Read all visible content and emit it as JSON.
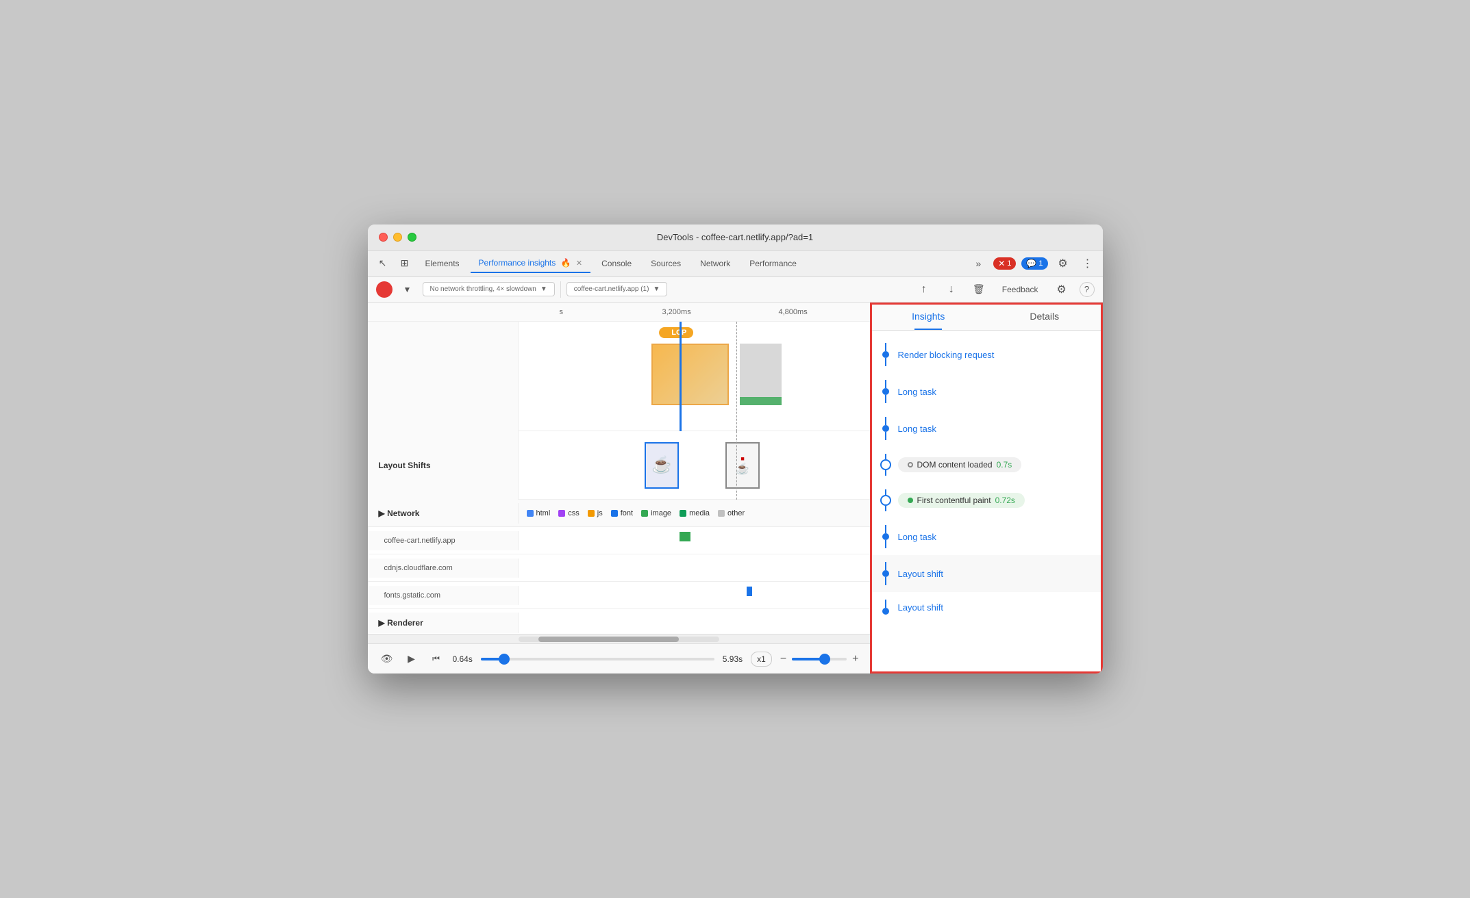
{
  "window": {
    "title": "DevTools - coffee-cart.netlify.app/?ad=1"
  },
  "tabs": [
    {
      "id": "elements",
      "label": "Elements",
      "active": false
    },
    {
      "id": "performance-insights",
      "label": "Performance insights",
      "active": true
    },
    {
      "id": "console",
      "label": "Console",
      "active": false
    },
    {
      "id": "sources",
      "label": "Sources",
      "active": false
    },
    {
      "id": "network",
      "label": "Network",
      "active": false
    },
    {
      "id": "performance",
      "label": "Performance",
      "active": false
    }
  ],
  "toolbar": {
    "throttling": "No network throttling, 4× slowdown",
    "url": "coffee-cart.netlify.app (1)",
    "feedback": "Feedback"
  },
  "timeline": {
    "markers": [
      {
        "time": "3,200ms",
        "left": "45%"
      },
      {
        "time": "4,800ms",
        "left": "64%"
      }
    ],
    "lcp_label": "LCP",
    "layout_shifts_label": "Layout Shifts",
    "network_label": "Network",
    "legend": [
      {
        "type": "html",
        "color": "#4285f4",
        "label": "html"
      },
      {
        "type": "css",
        "color": "#a142f4",
        "label": "css"
      },
      {
        "type": "js",
        "color": "#f29900",
        "label": "js"
      },
      {
        "type": "font",
        "color": "#1a73e8",
        "label": "font"
      },
      {
        "type": "image",
        "color": "#34a853",
        "label": "image"
      },
      {
        "type": "media",
        "color": "#0f9d58",
        "label": "media"
      },
      {
        "type": "other",
        "color": "#c0c0c0",
        "label": "other"
      }
    ],
    "network_rows": [
      {
        "label": "coffee-cart.netlify.app",
        "bar_color": "#34a853",
        "bar_left": "46%",
        "bar_width": "3%"
      },
      {
        "label": "cdnjs.cloudflare.com",
        "bar_color": "#1a73e8",
        "bar_left": "47%",
        "bar_width": "1%"
      },
      {
        "label": "fonts.gstatic.com",
        "bar_color": "#1a73e8",
        "bar_left": "65%",
        "bar_width": "1%"
      }
    ],
    "renderer_label": "Renderer"
  },
  "playback": {
    "current_time": "0.64s",
    "end_time": "5.93s",
    "speed": "x1"
  },
  "insights": {
    "tabs": [
      {
        "id": "insights",
        "label": "Insights",
        "active": true
      },
      {
        "id": "details",
        "label": "Details",
        "active": false
      }
    ],
    "items": [
      {
        "id": "render-blocking",
        "label": "Render blocking request",
        "type": "link",
        "node": "dot"
      },
      {
        "id": "long-task-1",
        "label": "Long task",
        "type": "link",
        "node": "dot"
      },
      {
        "id": "long-task-2",
        "label": "Long task",
        "type": "link",
        "node": "dot"
      },
      {
        "id": "dom-content-loaded",
        "label": "DOM content loaded",
        "time": "0.7s",
        "type": "tag-empty",
        "node": "circle-empty"
      },
      {
        "id": "first-contentful-paint",
        "label": "First contentful paint",
        "time": "0.72s",
        "type": "tag-green",
        "node": "circle-empty"
      },
      {
        "id": "long-task-3",
        "label": "Long task",
        "type": "link",
        "node": "dot"
      },
      {
        "id": "layout-shift-1",
        "label": "Layout shift",
        "type": "link",
        "node": "dot"
      },
      {
        "id": "layout-shift-2",
        "label": "Layout shift",
        "type": "link",
        "node": "dot"
      }
    ]
  },
  "badges": {
    "error": "1",
    "message": "1"
  },
  "icons": {
    "cursor": "↖",
    "layers": "⊞",
    "more": "»",
    "settings": "⚙",
    "three_dots": "⋮",
    "upload": "↑",
    "download": "↓",
    "trash": "🗑",
    "help": "?",
    "settings2": "⚙",
    "eye": "👁",
    "play": "▶",
    "skip_start": "⏮",
    "zoom_out": "−",
    "zoom_in": "+"
  }
}
